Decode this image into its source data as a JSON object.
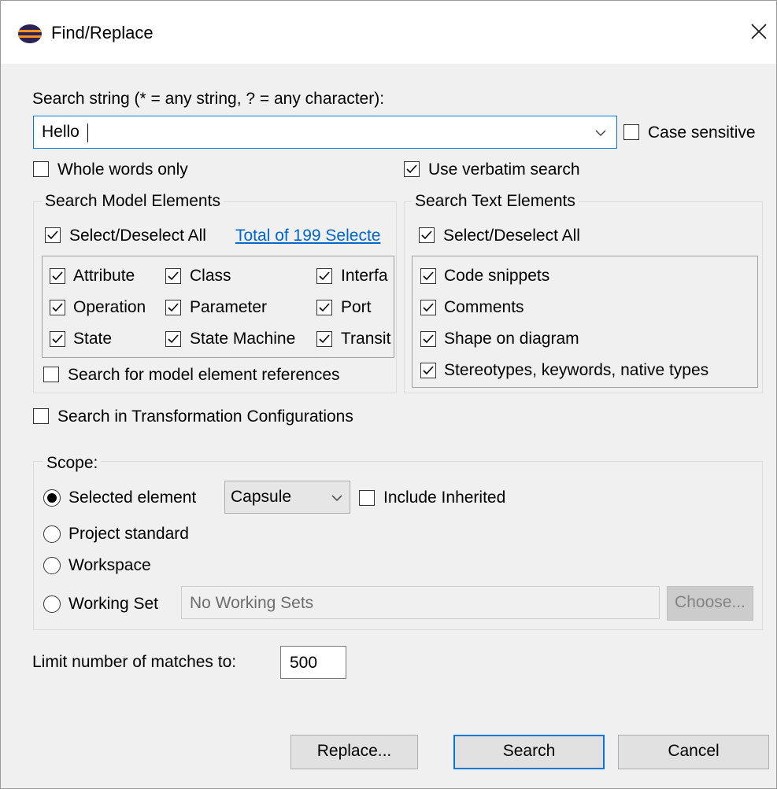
{
  "window": {
    "title": "Find/Replace",
    "icon": "eclipse-icon",
    "close_icon": "close-icon",
    "colors": {
      "accent": "#0078d7",
      "link": "#0066cc",
      "dialog_bg": "#f0f0f0"
    }
  },
  "search": {
    "label": "Search string (* = any string, ? = any character):",
    "value": "Hello",
    "case_sensitive": {
      "label": "Case sensitive",
      "checked": false
    },
    "whole_words": {
      "label": "Whole words only",
      "checked": false
    },
    "verbatim": {
      "label": "Use verbatim search",
      "checked": true
    }
  },
  "model_elements": {
    "legend": "Search Model Elements",
    "select_all": {
      "label": "Select/Deselect All",
      "checked": true
    },
    "total_link": "Total of 199 Selecte",
    "items": [
      {
        "label": "Attribute",
        "checked": true
      },
      {
        "label": "Class",
        "checked": true
      },
      {
        "label": "Interfa",
        "checked": true
      },
      {
        "label": "Operation",
        "checked": true
      },
      {
        "label": "Parameter",
        "checked": true
      },
      {
        "label": "Port",
        "checked": true
      },
      {
        "label": "State",
        "checked": true
      },
      {
        "label": "State Machine",
        "checked": true
      },
      {
        "label": "Transit",
        "checked": true
      }
    ],
    "references": {
      "label": "Search for model element references",
      "checked": false
    }
  },
  "text_elements": {
    "legend": "Search Text Elements",
    "select_all": {
      "label": "Select/Deselect All",
      "checked": true
    },
    "items": [
      {
        "label": "Code snippets",
        "checked": true
      },
      {
        "label": "Comments",
        "checked": true
      },
      {
        "label": "Shape on diagram",
        "checked": true
      },
      {
        "label": "Stereotypes, keywords, native types",
        "checked": true
      }
    ]
  },
  "transformation": {
    "label": "Search in Transformation Configurations",
    "checked": false
  },
  "scope": {
    "legend": "Scope:",
    "selected_element": {
      "label": "Selected element",
      "selected": true
    },
    "element_type": "Capsule",
    "include_inherited": {
      "label": "Include Inherited",
      "checked": false
    },
    "project_standard": {
      "label": "Project standard",
      "selected": false
    },
    "workspace": {
      "label": "Workspace",
      "selected": false
    },
    "working_set": {
      "label": "Working Set",
      "selected": false
    },
    "working_set_value": "No Working Sets",
    "choose_label": "Choose..."
  },
  "limit": {
    "label": "Limit number of matches to:",
    "value": "500"
  },
  "buttons": {
    "replace": "Replace...",
    "search": "Search",
    "cancel": "Cancel"
  }
}
